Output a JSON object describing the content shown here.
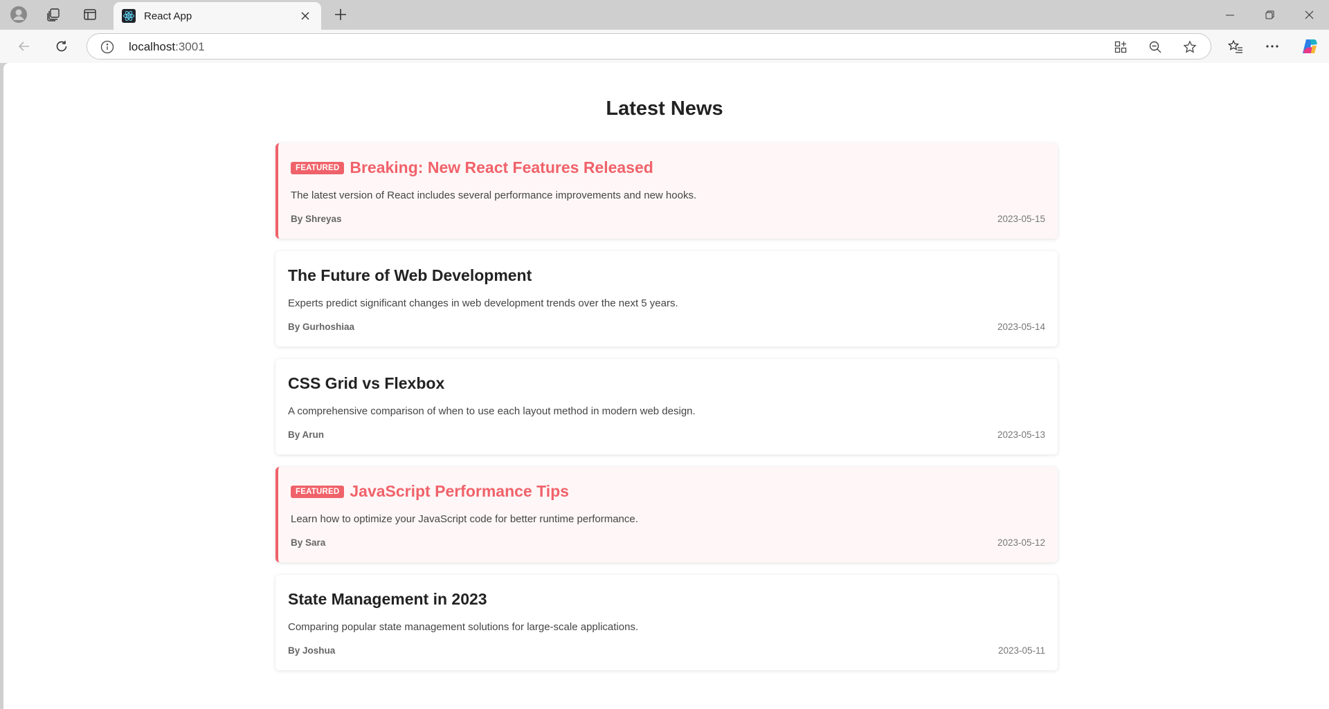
{
  "browser": {
    "tab_title": "React App",
    "address": {
      "host": "localhost",
      "port": ":3001"
    }
  },
  "page": {
    "title": "Latest News",
    "badge_label": "FEATURED",
    "articles": [
      {
        "featured": true,
        "title": "Breaking: New React Features Released",
        "description": "The latest version of React includes several performance improvements and new hooks.",
        "author": "By Shreyas",
        "date": "2023-05-15"
      },
      {
        "featured": false,
        "title": "The Future of Web Development",
        "description": "Experts predict significant changes in web development trends over the next 5 years.",
        "author": "By Gurhoshiaa",
        "date": "2023-05-14"
      },
      {
        "featured": false,
        "title": "CSS Grid vs Flexbox",
        "description": "A comprehensive comparison of when to use each layout method in modern web design.",
        "author": "By Arun",
        "date": "2023-05-13"
      },
      {
        "featured": true,
        "title": "JavaScript Performance Tips",
        "description": "Learn how to optimize your JavaScript code for better runtime performance.",
        "author": "By Sara",
        "date": "2023-05-12"
      },
      {
        "featured": false,
        "title": "State Management in 2023",
        "description": "Comparing popular state management solutions for large-scale applications.",
        "author": "By Joshua",
        "date": "2023-05-11"
      }
    ]
  },
  "colors": {
    "accent": "#f0626a",
    "featured_bg": "#fff7f7"
  }
}
